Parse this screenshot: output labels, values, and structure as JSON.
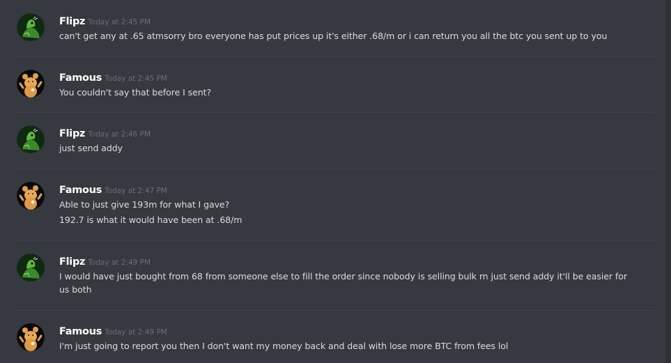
{
  "colors": {
    "background": "#36393f",
    "divider": "#40434a",
    "username": "#ffffff",
    "timestamp": "#6b6f76",
    "message_text": "#dcddde"
  },
  "messages": [
    {
      "author": "Flipz",
      "avatar": "green-creature-avatar",
      "time": "Today at 2:45 PM",
      "lines": [
        "can't get any at .65 atmsorry bro  everyone has put prices up it's either .68/m or i can return you all the btc you sent up to you"
      ]
    },
    {
      "author": "Famous",
      "avatar": "cartoon-bear-avatar",
      "time": "Today at 2:45 PM",
      "lines": [
        "You couldn't say that before I sent?"
      ]
    },
    {
      "author": "Flipz",
      "avatar": "green-creature-avatar",
      "time": "Today at 2:46 PM",
      "lines": [
        "just send addy"
      ]
    },
    {
      "author": "Famous",
      "avatar": "cartoon-bear-avatar",
      "time": "Today at 2:47 PM",
      "lines": [
        "Able to just give 193m for what I gave?",
        "192.7 is what it would have been at .68/m"
      ]
    },
    {
      "author": "Flipz",
      "avatar": "green-creature-avatar",
      "time": "Today at 2:49 PM",
      "lines": [
        "I would have just bought from 68 from someone else to fill the order since nobody is selling bulk rn just send addy it'll be easier for",
        "us both"
      ]
    },
    {
      "author": "Famous",
      "avatar": "cartoon-bear-avatar",
      "time": "Today at 2:49 PM",
      "lines": [
        "I'm just going to report you then I don't want my money back and deal with lose more BTC from fees lol"
      ]
    }
  ]
}
